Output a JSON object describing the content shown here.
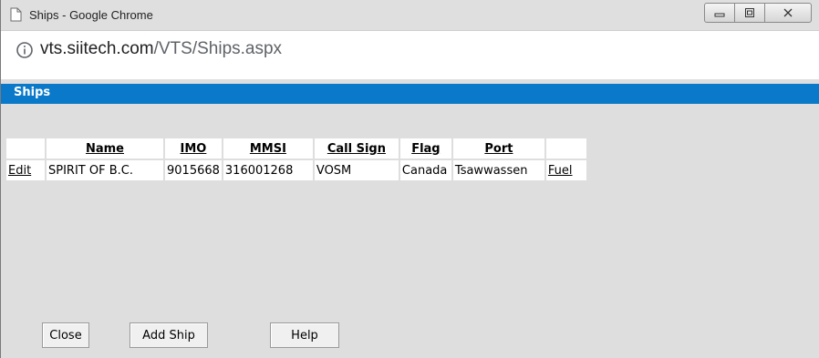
{
  "window": {
    "title": "Ships - Google Chrome",
    "url_host": "vts.siitech.com",
    "url_path": "/VTS/Ships.aspx"
  },
  "page": {
    "header": "Ships"
  },
  "table": {
    "columns": [
      "",
      "Name",
      "IMO",
      "MMSI",
      "Call Sign",
      "Flag",
      "Port",
      ""
    ],
    "rows": [
      {
        "edit": "Edit",
        "name": "SPIRIT OF B.C.",
        "imo": "9015668",
        "mmsi": "316001268",
        "call_sign": "VOSM",
        "flag": "Canada",
        "port": "Tsawwassen",
        "fuel": "Fuel"
      }
    ]
  },
  "buttons": {
    "close": "Close",
    "add_ship": "Add Ship",
    "help": "Help"
  },
  "colors": {
    "header_band": "#0a79c9",
    "page_background": "#dedede"
  }
}
